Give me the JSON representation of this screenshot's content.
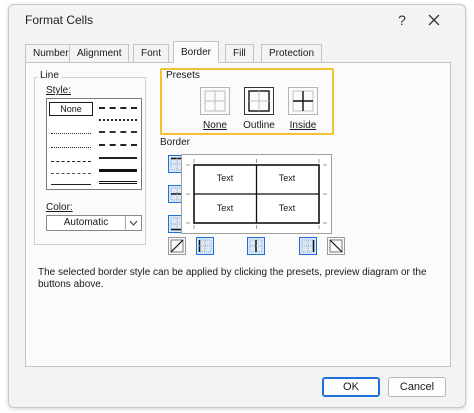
{
  "window": {
    "title": "Format Cells",
    "help_label": "?"
  },
  "tabs": [
    {
      "label": "Number",
      "active": false
    },
    {
      "label": "Alignment",
      "active": false
    },
    {
      "label": "Font",
      "active": false
    },
    {
      "label": "Border",
      "active": true
    },
    {
      "label": "Fill",
      "active": false
    },
    {
      "label": "Protection",
      "active": false
    }
  ],
  "line": {
    "group_label": "Line",
    "style_label": "Style:",
    "style_none": "None",
    "color_label": "Color:",
    "color_value": "Automatic"
  },
  "presets": {
    "group_label": "Presets",
    "items": [
      {
        "label": "None"
      },
      {
        "label": "Outline"
      },
      {
        "label": "Inside"
      }
    ]
  },
  "border": {
    "group_label": "Border",
    "preview_cells": [
      "Text",
      "Text",
      "Text",
      "Text"
    ]
  },
  "description": "The selected border style can be applied by clicking the presets, preview diagram or the buttons above.",
  "buttons": {
    "ok": "OK",
    "cancel": "Cancel"
  },
  "colors": {
    "highlight": "#f2c233",
    "accent": "#1e6fd9"
  }
}
